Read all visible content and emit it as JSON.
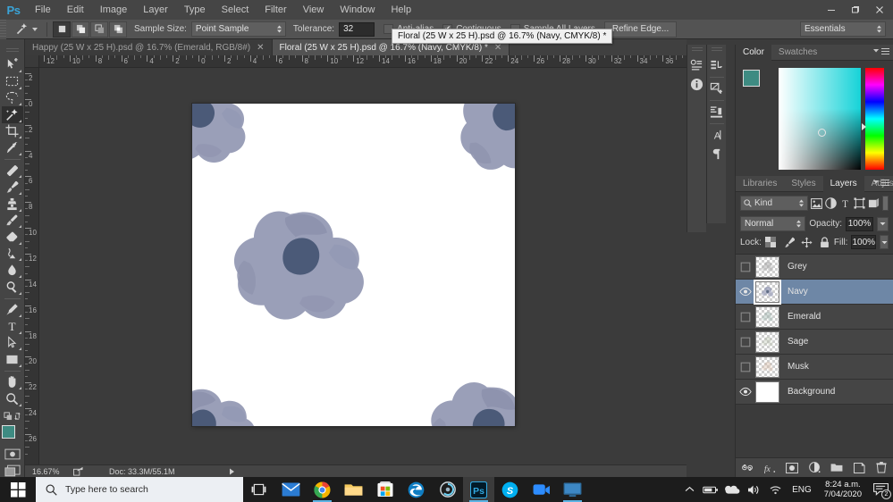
{
  "app": {
    "name": "Photoshop",
    "logo_text": "Ps"
  },
  "menubar": {
    "items": [
      "File",
      "Edit",
      "Image",
      "Layer",
      "Type",
      "Select",
      "Filter",
      "View",
      "Window",
      "Help"
    ],
    "minimize": "—",
    "maximize": "❐",
    "close": "✕"
  },
  "options_bar": {
    "tool_icon": "magic-wand-icon",
    "selection_modes": [
      "new-selection",
      "add-to-selection",
      "subtract-from-selection",
      "intersect-with-selection"
    ],
    "sample_size_label": "Sample Size:",
    "sample_size_value": "Point Sample",
    "tolerance_label": "Tolerance:",
    "tolerance_value": "32",
    "anti_alias_label": "Anti-alias",
    "anti_alias_checked": false,
    "contiguous_label": "Contiguous",
    "contiguous_checked": true,
    "sample_all_layers_label": "Sample All Layers",
    "sample_all_layers_checked": false,
    "refine_edge_label": "Refine Edge...",
    "workspace": "Essentials"
  },
  "tooltip": {
    "text": "Floral (25 W x 25 H).psd @ 16.7% (Navy, CMYK/8) *"
  },
  "tabs": [
    {
      "label": "Happy (25 W x 25 H).psd @ 16.7% (Emerald, RGB/8#)",
      "active": false,
      "close": "✕"
    },
    {
      "label": "Floral (25 W x 25 H).psd @ 16.7% (Navy, CMYK/8) *",
      "active": true,
      "close": "✕"
    }
  ],
  "toolbar": {
    "tools": [
      {
        "name": "move-tool",
        "active": false
      },
      {
        "name": "rectangular-marquee-tool",
        "active": false
      },
      {
        "name": "lasso-tool",
        "active": false
      },
      {
        "name": "magic-wand-tool",
        "active": true
      },
      {
        "name": "crop-tool",
        "active": false
      },
      {
        "name": "eyedropper-tool",
        "active": false
      },
      {
        "name": "spot-healing-brush-tool",
        "active": false
      },
      {
        "name": "brush-tool",
        "active": false
      },
      {
        "name": "clone-stamp-tool",
        "active": false
      },
      {
        "name": "history-brush-tool",
        "active": false
      },
      {
        "name": "eraser-tool",
        "active": false
      },
      {
        "name": "gradient-tool",
        "active": false
      },
      {
        "name": "blur-tool",
        "active": false
      },
      {
        "name": "dodge-tool",
        "active": false
      },
      {
        "name": "pen-tool",
        "active": false
      },
      {
        "name": "horizontal-type-tool",
        "active": false
      },
      {
        "name": "path-selection-tool",
        "active": false
      },
      {
        "name": "rectangle-tool",
        "active": false
      },
      {
        "name": "hand-tool",
        "active": false
      },
      {
        "name": "zoom-tool",
        "active": false
      }
    ],
    "foreground_color": "#3e8b82",
    "background_color": "#e8d9c8",
    "quick_mask": "edit-in-quick-mask-mode",
    "screen_mode": "change-screen-mode"
  },
  "rulers": {
    "horizontal": [
      "12",
      "10",
      "8",
      "6",
      "4",
      "2",
      "0",
      "2",
      "4",
      "6",
      "8",
      "10",
      "12",
      "14",
      "16",
      "18",
      "20",
      "22",
      "24",
      "26",
      "28",
      "30",
      "32",
      "34",
      "36"
    ],
    "vertical": [
      "2",
      "0",
      "2",
      "4",
      "6",
      "8",
      "10",
      "12",
      "14",
      "16",
      "18",
      "20",
      "22",
      "24",
      "26"
    ],
    "unit": "inches"
  },
  "canvas": {
    "document_name": "Floral (25 W x 25 H).psd",
    "background": "#ffffff",
    "flower_colors": {
      "petal_light": "#9499b4",
      "petal_mid": "#878ca9",
      "petal_dark": "#8a8fac",
      "center_dark": "#3c4d6d"
    }
  },
  "statusbar": {
    "zoom": "16.67%",
    "doc_label": "Doc:",
    "doc_size": "33.3M/55.1M",
    "arrow_icon": "share-arrow-icon",
    "play_icon": "play-arrow-icon"
  },
  "icon_docks": {
    "column_a": [
      "character-styles-icon",
      "info-icon"
    ],
    "column_b": [
      "history-icon",
      "properties-icon",
      "adjustments-icon",
      "character-icon",
      "paragraph-icon"
    ]
  },
  "color_panel": {
    "tabs": [
      {
        "label": "Color",
        "active": true
      },
      {
        "label": "Swatches",
        "active": false
      }
    ],
    "foreground_color": "#3e8b82",
    "background_color": "#e8d9c8",
    "picker_base_color": "#16d3d8",
    "menu_icon": "panel-menu-icon"
  },
  "layers_panel": {
    "tabs": [
      {
        "label": "Libraries",
        "active": false
      },
      {
        "label": "Styles",
        "active": false
      },
      {
        "label": "Layers",
        "active": true
      },
      {
        "label": "Adjustments",
        "active": false
      }
    ],
    "menu_icon": "panel-menu-icon",
    "filter_label": "Kind",
    "filter_icons": [
      "pixel-filter-icon",
      "adjustment-filter-icon",
      "type-filter-icon",
      "shape-filter-icon",
      "smart-object-filter-icon"
    ],
    "blend_mode": "Normal",
    "opacity_label": "Opacity:",
    "opacity_value": "100%",
    "lock_label": "Lock:",
    "lock_icons": [
      "lock-transparent-pixels-icon",
      "lock-image-pixels-icon",
      "lock-position-icon",
      "lock-all-icon"
    ],
    "fill_label": "Fill:",
    "fill_value": "100%",
    "layers": [
      {
        "name": "Grey",
        "visible": false,
        "selected": false,
        "type": "transparent"
      },
      {
        "name": "Navy",
        "visible": true,
        "selected": true,
        "type": "transparent"
      },
      {
        "name": "Emerald",
        "visible": false,
        "selected": false,
        "type": "transparent"
      },
      {
        "name": "Sage",
        "visible": false,
        "selected": false,
        "type": "transparent"
      },
      {
        "name": "Musk",
        "visible": false,
        "selected": false,
        "type": "transparent"
      },
      {
        "name": "Background",
        "visible": true,
        "selected": false,
        "type": "white"
      }
    ],
    "bottom_icons": [
      "link-layers-icon",
      "layer-style-fx-icon",
      "add-layer-mask-icon",
      "new-adjustment-layer-icon",
      "new-group-icon",
      "new-layer-icon",
      "delete-layer-icon"
    ]
  },
  "taskbar": {
    "start": "windows-start-icon",
    "search_placeholder": "Type here to search",
    "search_icon": "search-icon",
    "task_view": "task-view-icon",
    "apps": [
      {
        "name": "mail-app-icon",
        "running": false,
        "active": false
      },
      {
        "name": "chrome-app-icon",
        "running": true,
        "active": false
      },
      {
        "name": "file-explorer-app-icon",
        "running": false,
        "active": false
      },
      {
        "name": "microsoft-store-app-icon",
        "running": false,
        "active": false
      },
      {
        "name": "edge-app-icon",
        "running": false,
        "active": false
      },
      {
        "name": "cortana-app-icon",
        "running": false,
        "active": false
      },
      {
        "name": "photoshop-app-icon",
        "running": true,
        "active": true
      },
      {
        "name": "skype-app-icon",
        "running": false,
        "active": false
      },
      {
        "name": "zoom-app-icon",
        "running": false,
        "active": false
      },
      {
        "name": "remote-desktop-app-icon",
        "running": true,
        "active": false
      }
    ],
    "tray": {
      "chevron": "show-hidden-icons-icon",
      "battery": "battery-icon",
      "onedrive": "onedrive-icon",
      "volume": "volume-icon",
      "wifi": "wifi-icon",
      "language": "ENG",
      "time": "8:24 a.m.",
      "date": "7/04/2020",
      "notifications": "notification-center-icon",
      "notification_count": "2"
    }
  }
}
